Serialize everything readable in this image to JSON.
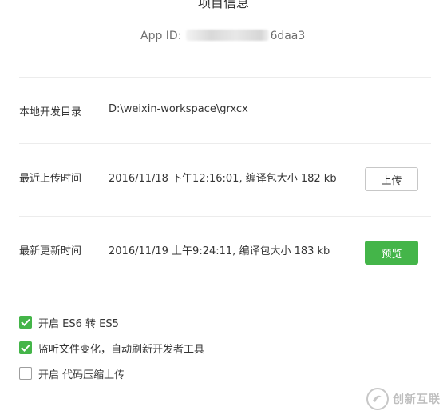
{
  "header": {
    "title_partial": "项目信息",
    "app_id_label": "App ID:",
    "app_id_suffix": "6daa3"
  },
  "info": {
    "local_dir_label": "本地开发目录",
    "local_dir_value": "D:\\weixin-workspace\\grxcx",
    "last_upload_label": "最近上传时间",
    "last_upload_value": "2016/11/18 下午12:16:01, 编译包大小 182 kb",
    "upload_button": "上传",
    "last_update_label": "最新更新时间",
    "last_update_value": "2016/11/19 上午9:24:11, 编译包大小 183 kb",
    "preview_button": "预览"
  },
  "options": [
    {
      "label": "开启 ES6 转 ES5",
      "checked": true
    },
    {
      "label": "监听文件变化，自动刷新开发者工具",
      "checked": true
    },
    {
      "label": "开启 代码压缩上传",
      "checked": false
    }
  ],
  "watermark": {
    "text": "创新互联"
  },
  "colors": {
    "accent": "#44b549",
    "text": "#353535",
    "divider": "#ececec"
  }
}
